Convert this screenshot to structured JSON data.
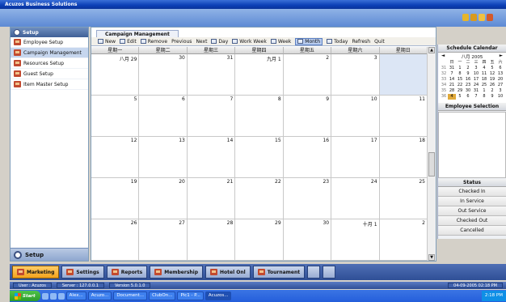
{
  "window": {
    "title": "Acuzos Business Solutions"
  },
  "setup_panel": {
    "header": "Setup",
    "items": [
      {
        "label": "Employee Setup",
        "active": false
      },
      {
        "label": "Campaign Management",
        "active": true
      },
      {
        "label": "Resources Setup",
        "active": false
      },
      {
        "label": "Guest Setup",
        "active": false
      },
      {
        "label": "Item Master Setup",
        "active": false
      }
    ],
    "footer_label": "Setup"
  },
  "main": {
    "tab_label": "Campaign Management",
    "toolbar": [
      {
        "label": "New",
        "icon": "new-icon",
        "active": false
      },
      {
        "label": "Edit",
        "icon": "edit-icon",
        "active": false
      },
      {
        "label": "Remove",
        "icon": "remove-icon",
        "active": false
      },
      {
        "label": "Previous",
        "icon": "",
        "active": false
      },
      {
        "label": "Next",
        "icon": "",
        "active": false
      },
      {
        "label": "Day",
        "icon": "day-view-icon",
        "active": false
      },
      {
        "label": "Work Week",
        "icon": "work-week-icon",
        "active": false
      },
      {
        "label": "Week",
        "icon": "week-view-icon",
        "active": false
      },
      {
        "label": "Month",
        "icon": "month-view-icon",
        "active": true
      },
      {
        "label": "Today",
        "icon": "today-icon",
        "active": false
      },
      {
        "label": "Refresh",
        "icon": "",
        "active": false
      },
      {
        "label": "Quit",
        "icon": "",
        "active": false
      }
    ],
    "calendar": {
      "weekdays": [
        "星期一",
        "星期二",
        "星期三",
        "星期四",
        "星期五",
        "星期六",
        "星期日"
      ],
      "weeks": [
        [
          "八月 29",
          "30",
          "31",
          "九月 1",
          "2",
          "3",
          ""
        ],
        [
          "5",
          "6",
          "7",
          "8",
          "9",
          "10",
          "11"
        ],
        [
          "12",
          "13",
          "14",
          "15",
          "16",
          "17",
          "18"
        ],
        [
          "19",
          "20",
          "21",
          "22",
          "23",
          "24",
          "25"
        ],
        [
          "26",
          "27",
          "28",
          "29",
          "30",
          "十月 1",
          "2"
        ]
      ]
    }
  },
  "schedule_calendar": {
    "title": "Schedule Calendar",
    "month_label": "八月 2005",
    "weekdays": [
      "日",
      "一",
      "二",
      "三",
      "四",
      "五",
      "六"
    ],
    "rows": [
      [
        "31",
        "31",
        "1",
        "2",
        "3",
        "4",
        "5",
        "6"
      ],
      [
        "32",
        "7",
        "8",
        "9",
        "10",
        "11",
        "12",
        "13"
      ],
      [
        "33",
        "14",
        "15",
        "16",
        "17",
        "18",
        "19",
        "20"
      ],
      [
        "34",
        "21",
        "22",
        "23",
        "24",
        "25",
        "26",
        "27"
      ],
      [
        "35",
        "28",
        "29",
        "30",
        "31",
        "1",
        "2",
        "3"
      ],
      [
        "36",
        "4",
        "5",
        "6",
        "7",
        "8",
        "9",
        "10"
      ]
    ]
  },
  "employee_selection": {
    "title": "Employee Selection"
  },
  "status_panel": {
    "title": "Status",
    "items": [
      "Checked In",
      "In Service",
      "Out Service",
      "Checked Out",
      "Cancelled"
    ]
  },
  "module_nav": [
    {
      "label": "Marketing",
      "active": true
    },
    {
      "label": "Settings",
      "active": false
    },
    {
      "label": "Reports",
      "active": false
    },
    {
      "label": "Membership",
      "active": false
    },
    {
      "label": "Hotel Onl",
      "active": false
    },
    {
      "label": "Tournament",
      "active": false
    }
  ],
  "statusbar": {
    "user": "User : Acuzos",
    "server": "Server : 127.0.0.1",
    "version": "Version 5.0.1.0",
    "datetime": "04-09-2005 02:18 PM"
  },
  "windows_taskbar": {
    "start_label": "Start",
    "tasks": [
      "Alex...",
      "Acuzo...",
      "Document...",
      "ClubOn...",
      "Pic1 - P...",
      "Acuzos..."
    ],
    "clock": "2:18 PM"
  },
  "colors": {
    "accent": "#f3a31d",
    "titlebar": "#0b3fb5",
    "selected_day": "#dce6f5"
  }
}
